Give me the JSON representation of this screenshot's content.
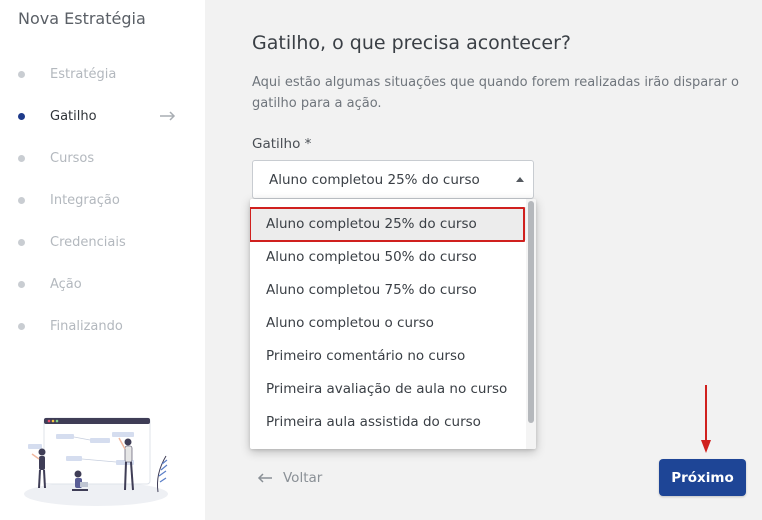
{
  "sidebar": {
    "title": "Nova Estratégia",
    "steps": [
      {
        "label": "Estratégia",
        "active": false
      },
      {
        "label": "Gatilho",
        "active": true
      },
      {
        "label": "Cursos",
        "active": false
      },
      {
        "label": "Integração",
        "active": false
      },
      {
        "label": "Credenciais",
        "active": false
      },
      {
        "label": "Ação",
        "active": false
      },
      {
        "label": "Finalizando",
        "active": false
      }
    ]
  },
  "main": {
    "title": "Gatilho, o que precisa acontecer?",
    "description": "Aqui estão algumas situações que quando forem realizadas irão disparar o gatilho para a ação.",
    "field_label": "Gatilho *",
    "select_value": "Aluno completou 25% do curso",
    "options": [
      "Aluno completou 25% do curso",
      "Aluno completou 50% do curso",
      "Aluno completou 75% do curso",
      "Aluno completou o curso",
      "Primeiro comentário no curso",
      "Primeira avaliação de aula no curso",
      "Primeira aula assistida do curso"
    ],
    "selected_index": 0,
    "back_label": "Voltar",
    "next_label": "Próximo"
  },
  "colors": {
    "primary": "#1e4596",
    "active_dot": "#1e3a8a",
    "annotation_red": "#d0201e",
    "main_bg": "#f2f2f2"
  },
  "icons": {
    "active_step": "arrow-right-icon",
    "back": "arrow-left-icon",
    "select": "caret-up-icon"
  }
}
